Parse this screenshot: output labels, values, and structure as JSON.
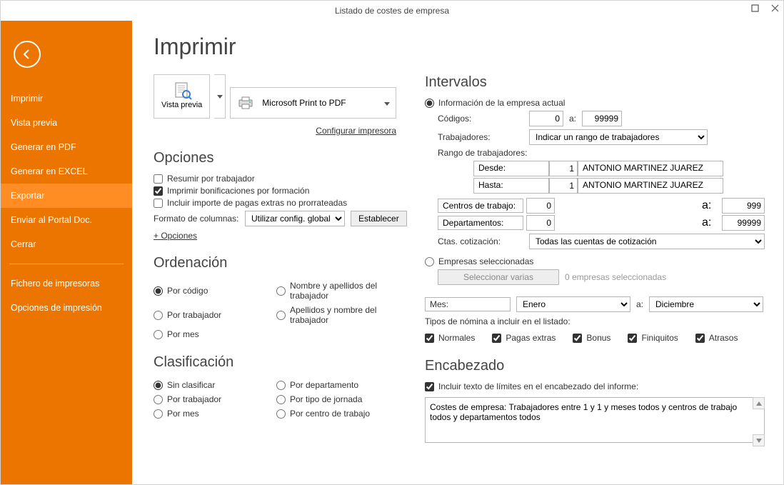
{
  "window": {
    "title": "Listado de costes de empresa"
  },
  "sidebar": {
    "items": [
      {
        "label": "Imprimir"
      },
      {
        "label": "Vista previa"
      },
      {
        "label": "Generar en PDF"
      },
      {
        "label": "Generar en EXCEL"
      },
      {
        "label": "Exportar",
        "selected": true
      },
      {
        "label": "Enviar al Portal Doc."
      },
      {
        "label": "Cerrar"
      }
    ],
    "items2": [
      {
        "label": "Fichero de impresoras"
      },
      {
        "label": "Opciones de impresión"
      }
    ]
  },
  "page": {
    "title": "Imprimir"
  },
  "preview": {
    "btn_label": "Vista previa",
    "printer": "Microsoft Print to PDF",
    "configure": "Configurar impresora"
  },
  "opciones": {
    "title": "Opciones",
    "resumir": "Resumir por trabajador",
    "bonif": "Imprimir bonificaciones por formación",
    "pagas": "Incluir importe de pagas extras no prorrateadas",
    "formato_label": "Formato de columnas:",
    "formato_val": "Utilizar config. global",
    "establecer": "Establecer",
    "mas": "+ Opciones"
  },
  "ordenacion": {
    "title": "Ordenación",
    "por_codigo": "Por código",
    "por_trab": "Por trabajador",
    "por_mes": "Por mes",
    "nom_ape": "Nombre y apellidos del trabajador",
    "ape_nom": "Apellidos y nombre del trabajador"
  },
  "clasificacion": {
    "title": "Clasificación",
    "sin": "Sin clasificar",
    "por_trab": "Por trabajador",
    "por_mes": "Por mes",
    "por_dept": "Por departamento",
    "por_jorn": "Por tipo de jornada",
    "por_centro": "Por centro de trabajo"
  },
  "intervalos": {
    "title": "Intervalos",
    "info_empresa": "Información de la empresa actual",
    "codigos": "Códigos:",
    "cod_from": "0",
    "a": "a:",
    "cod_to": "99999",
    "trabajadores": "Trabajadores:",
    "trab_sel": "Indicar un rango de trabajadores",
    "rango_lbl": "Rango de trabajadores:",
    "desde": "Desde:",
    "hasta": "Hasta:",
    "desde_n": "1",
    "hasta_n": "1",
    "nombre": "ANTONIO MARTINEZ JUAREZ",
    "centros": "Centros de trabajo:",
    "centros_from": "0",
    "centros_to": "999",
    "dept": "Departamentos:",
    "dept_from": "0",
    "dept_to": "99999",
    "ctas": "Ctas. cotización:",
    "ctas_sel": "Todas las cuentas de cotización",
    "emp_sel": "Empresas seleccionadas",
    "sel_varias": "Seleccionar varias",
    "emp_count": "0 empresas seleccionadas",
    "mes": "Mes:",
    "mes_from": "Enero",
    "mes_to": "Diciembre",
    "tipos_lbl": "Tipos de nómina a incluir en el listado:",
    "normales": "Normales",
    "pagas": "Pagas extras",
    "bonus": "Bonus",
    "finiq": "Finiquitos",
    "atrasos": "Atrasos"
  },
  "encabezado": {
    "title": "Encabezado",
    "incluir": "Incluir texto de límites en el encabezado del informe:",
    "text": "Costes de empresa: Trabajadores entre 1 y 1 y meses todos y centros de trabajo todos y departamentos todos"
  }
}
